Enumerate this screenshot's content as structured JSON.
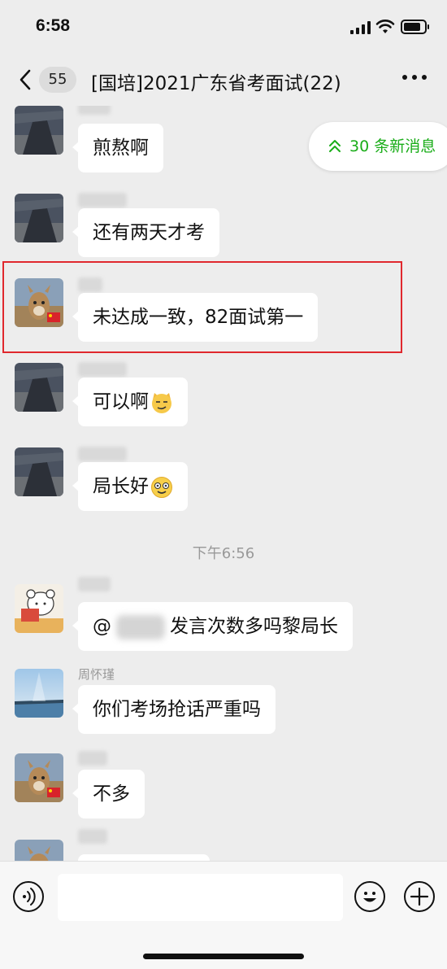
{
  "status": {
    "time": "6:58",
    "battery_level": 0.85
  },
  "header": {
    "back_count": "55",
    "title": "[国培]2021广东省考面试(22)",
    "more_icon": "more-dots-icon"
  },
  "new_messages": {
    "label": "30 条新消息",
    "icon": "double-chevron-up-icon"
  },
  "messages": [
    {
      "sender": "",
      "text": "煎熬啊",
      "avatar": "photo-avatar-dark"
    },
    {
      "sender": "",
      "text": "还有两天才考",
      "avatar": "photo-avatar-dark"
    },
    {
      "sender": "",
      "text": "未达成一致，82面试第一",
      "avatar": "alpaca-avatar"
    },
    {
      "sender": "",
      "text": "可以啊",
      "emoji": "smirk-cat-emoji",
      "avatar": "photo-avatar-dark"
    },
    {
      "sender": "",
      "text": "局长好",
      "emoji": "dizzy-smile-emoji",
      "avatar": "photo-avatar-dark"
    },
    {
      "sender": "",
      "mention_prefix": "@",
      "text": "发言次数多吗黎局长",
      "avatar": "bear-reading-avatar"
    },
    {
      "sender": "周怀瑾",
      "text": "你们考场抢话严重吗",
      "avatar": "sea-sky-avatar"
    },
    {
      "sender": "",
      "text": "不多",
      "avatar": "alpaca-avatar"
    }
  ],
  "time_divider": "下午6:56",
  "colors": {
    "accent_green": "#1aad19",
    "highlight_red": "#e0282e",
    "chat_bg": "#ededed"
  },
  "input": {
    "placeholder": "",
    "value": ""
  }
}
